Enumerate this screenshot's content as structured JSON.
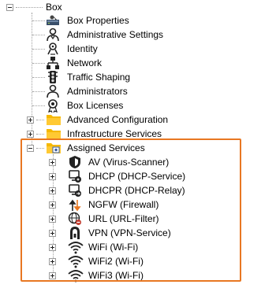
{
  "colors": {
    "highlight_border": "#e87722",
    "folder": "#f5b800",
    "tree_line": "#a0a0a0"
  },
  "tree": {
    "root": {
      "label": "Box",
      "icon": "minus-toggle"
    },
    "items": [
      {
        "label": "Box Properties",
        "icon": "box-properties-icon"
      },
      {
        "label": "Administrative Settings",
        "icon": "admin-settings-icon"
      },
      {
        "label": "Identity",
        "icon": "identity-icon"
      },
      {
        "label": "Network",
        "icon": "network-icon"
      },
      {
        "label": "Traffic Shaping",
        "icon": "traffic-shaping-icon"
      },
      {
        "label": "Administrators",
        "icon": "administrators-icon"
      },
      {
        "label": "Box Licenses",
        "icon": "box-licenses-icon"
      },
      {
        "label": "Advanced Configuration",
        "icon": "folder-icon"
      },
      {
        "label": "Infrastructure Services",
        "icon": "folder-icon"
      },
      {
        "label": "Assigned Services",
        "icon": "folder-services-icon"
      }
    ],
    "services": [
      {
        "label": "AV (Virus-Scanner)",
        "icon": "virus-scanner-icon"
      },
      {
        "label": "DHCP (DHCP-Service)",
        "icon": "dhcp-icon"
      },
      {
        "label": "DHCPR (DHCP-Relay)",
        "icon": "dhcp-relay-icon"
      },
      {
        "label": "NGFW (Firewall)",
        "icon": "firewall-icon"
      },
      {
        "label": "URL (URL-Filter)",
        "icon": "url-filter-icon"
      },
      {
        "label": "VPN (VPN-Service)",
        "icon": "vpn-icon"
      },
      {
        "label": "WiFi (Wi-Fi)",
        "icon": "wifi-icon"
      },
      {
        "label": "WiFi2 (Wi-Fi)",
        "icon": "wifi-icon"
      },
      {
        "label": "WiFi3 (Wi-Fi)",
        "icon": "wifi-icon"
      }
    ]
  }
}
